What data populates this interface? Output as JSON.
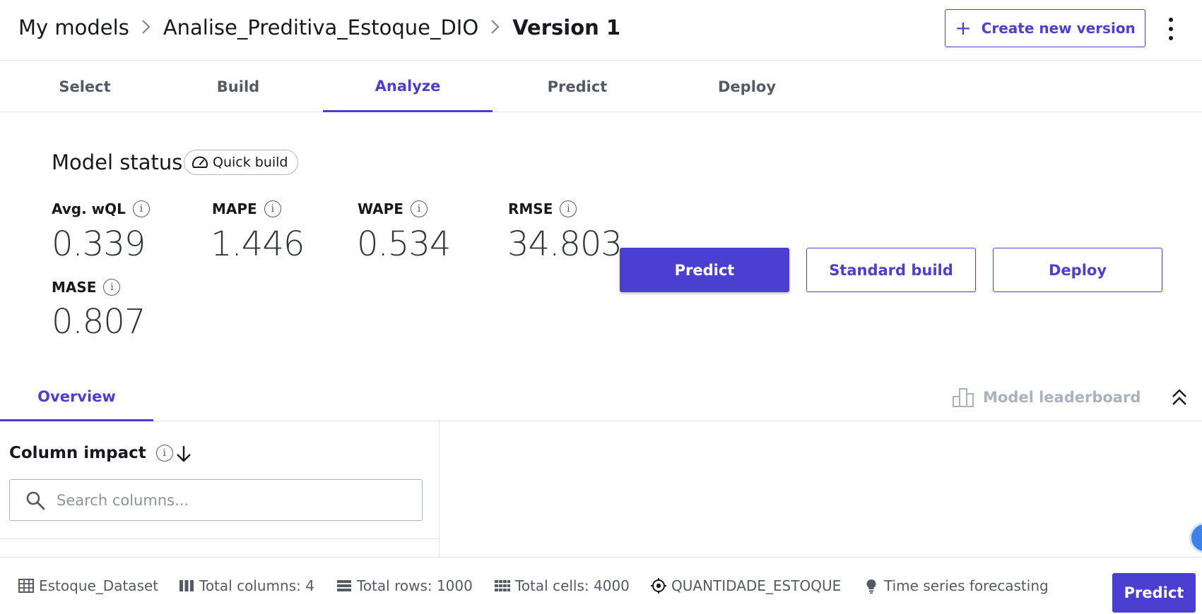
{
  "breadcrumb": {
    "items": [
      "My models",
      "Analise_Preditiva_Estoque_DIO",
      "Version 1"
    ]
  },
  "header": {
    "create_version_label": "Create new version"
  },
  "tabs": [
    {
      "label": "Select",
      "active": false
    },
    {
      "label": "Build",
      "active": false
    },
    {
      "label": "Analyze",
      "active": true
    },
    {
      "label": "Predict",
      "active": false
    },
    {
      "label": "Deploy",
      "active": false
    }
  ],
  "model_status": {
    "title": "Model status",
    "badge": "Quick build",
    "metrics": [
      {
        "label": "Avg. wQL",
        "value": "0.339"
      },
      {
        "label": "MAPE",
        "value": "1.446"
      },
      {
        "label": "WAPE",
        "value": "0.534"
      },
      {
        "label": "RMSE",
        "value": "34.803"
      },
      {
        "label": "MASE",
        "value": "0.807"
      }
    ],
    "actions": {
      "predict": "Predict",
      "standard_build": "Standard build",
      "deploy": "Deploy"
    }
  },
  "subtabs": {
    "overview": "Overview",
    "leaderboard": "Model leaderboard"
  },
  "column_impact": {
    "title": "Column impact",
    "search_placeholder": "Search columns..."
  },
  "footer": {
    "dataset": "Estoque_Dataset",
    "total_columns": "Total columns: 4",
    "total_rows": "Total rows: 1000",
    "total_cells": "Total cells: 4000",
    "target": "QUANTIDADE_ESTOQUE",
    "problem_type": "Time series forecasting",
    "predict_label": "Predict"
  },
  "colors": {
    "accent": "#4b3fd1",
    "text": "#16191f",
    "muted": "#545b64",
    "disabled": "#aab2bd"
  }
}
